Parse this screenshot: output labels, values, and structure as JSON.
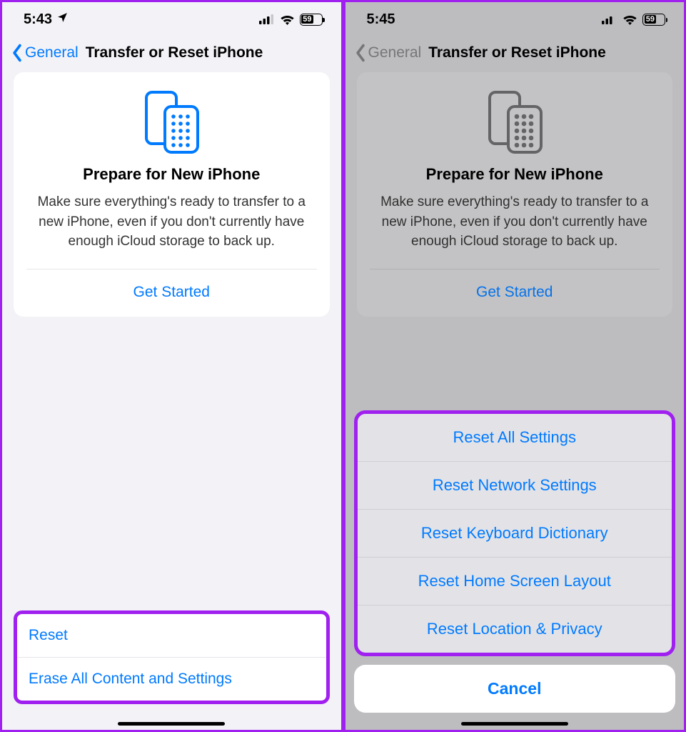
{
  "left": {
    "status": {
      "time": "5:43",
      "battery": "59"
    },
    "nav": {
      "back": "General",
      "title": "Transfer or Reset iPhone"
    },
    "card": {
      "title": "Prepare for New iPhone",
      "desc": "Make sure everything's ready to transfer to a new iPhone, even if you don't currently have enough iCloud storage to back up.",
      "cta": "Get Started"
    },
    "rows": {
      "reset": "Reset",
      "erase": "Erase All Content and Settings"
    }
  },
  "right": {
    "status": {
      "time": "5:45",
      "battery": "59"
    },
    "nav": {
      "back": "General",
      "title": "Transfer or Reset iPhone"
    },
    "card": {
      "title": "Prepare for New iPhone",
      "desc": "Make sure everything's ready to transfer to a new iPhone, even if you don't currently have enough iCloud storage to back up.",
      "cta": "Get Started"
    },
    "sheet": {
      "o1": "Reset All Settings",
      "o2": "Reset Network Settings",
      "o3": "Reset Keyboard Dictionary",
      "o4": "Reset Home Screen Layout",
      "o5": "Reset Location & Privacy",
      "cancel": "Cancel"
    }
  }
}
